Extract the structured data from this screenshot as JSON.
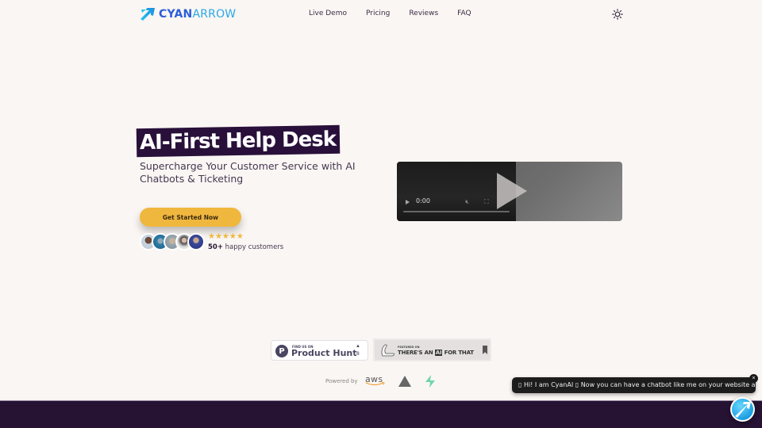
{
  "nav": {
    "logo_part1": "CYAN",
    "logo_part2": "ARROW",
    "links": [
      "Live Demo",
      "Pricing",
      "Reviews",
      "FAQ"
    ],
    "theme_icon": "sun-icon"
  },
  "hero": {
    "title": "AI-First Help Desk",
    "subtitle": "Supercharge Your Customer Service with AI Chatbots & Ticketing",
    "cta_label": "Get Started Now",
    "stars": "★★★★★",
    "rating_stars": 5,
    "customers_count": "50+",
    "customers_label": " happy customers"
  },
  "video": {
    "time": "0:00",
    "play_icon": "play-icon",
    "mute_icon": "muted-icon",
    "fullscreen_icon": "fullscreen-icon",
    "progress": 0
  },
  "badges": {
    "product_hunt": {
      "small": "FIND US ON",
      "big": "Product Hunt",
      "upvote_icon": "▲",
      "count": "8"
    },
    "taaft": {
      "small": "FEATURED ON",
      "big_pre": "THERE'S AN ",
      "big_ai": "AI",
      "big_post": " FOR THAT"
    }
  },
  "powered": {
    "label": "Powered by",
    "providers": [
      "aws",
      "vercel",
      "supabase"
    ],
    "aws_text": "aws"
  },
  "chat": {
    "message": "▯ Hi! I am CyanAI ▯ Now you can have a chatbot like me on your website as well 😇",
    "close_label": "×"
  },
  "colors": {
    "background": "#faf6f3",
    "title_bg": "#28103a",
    "cta": "#f0b73e",
    "footer": "#261233",
    "logo_blue": "#2b5fd9",
    "logo_cyan": "#29a9e8"
  }
}
